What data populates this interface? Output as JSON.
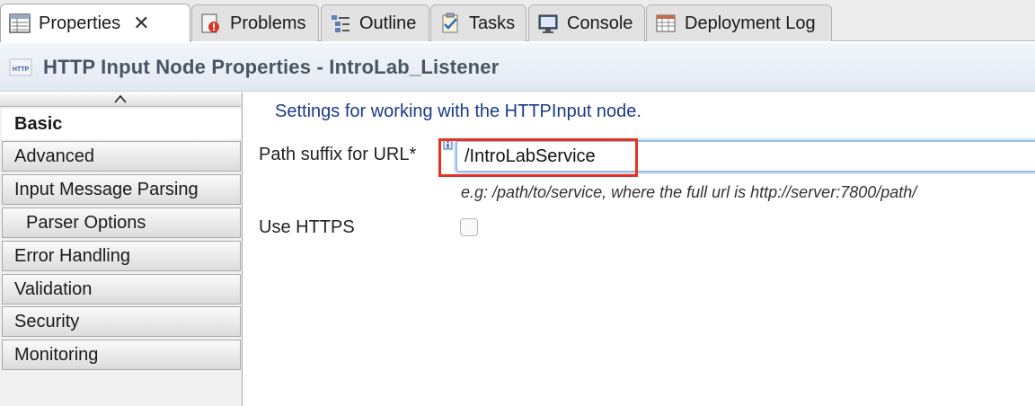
{
  "tabs": [
    {
      "label": "Properties",
      "icon": "properties-icon",
      "active": true
    },
    {
      "label": "Problems",
      "icon": "problems-icon"
    },
    {
      "label": "Outline",
      "icon": "outline-icon"
    },
    {
      "label": "Tasks",
      "icon": "tasks-icon"
    },
    {
      "label": "Console",
      "icon": "console-icon"
    },
    {
      "label": "Deployment Log",
      "icon": "deployment-log-icon"
    }
  ],
  "tab_close_glyph": "✕",
  "header": {
    "logo_text": "HTTP",
    "title": "HTTP Input Node Properties - IntroLab_Listener"
  },
  "nav": {
    "items": [
      {
        "label": "Basic",
        "selected": true
      },
      {
        "label": "Advanced"
      },
      {
        "label": "Input Message Parsing"
      },
      {
        "label": "Parser Options",
        "sub": true
      },
      {
        "label": "Error Handling"
      },
      {
        "label": "Validation"
      },
      {
        "label": "Security"
      },
      {
        "label": "Monitoring"
      }
    ]
  },
  "main": {
    "heading": "Settings for working with the HTTPInput node.",
    "path_suffix": {
      "label": "Path suffix for URL*",
      "value": "/IntroLabService"
    },
    "example": "e.g: /path/to/service, where the full url is http://server:7800/path/",
    "use_https": {
      "label": "Use HTTPS",
      "checked": false
    }
  },
  "colors": {
    "highlight_box": "#e8321f",
    "heading_text": "#1a3b8a",
    "input_focus_border": "#9bbbe6"
  }
}
